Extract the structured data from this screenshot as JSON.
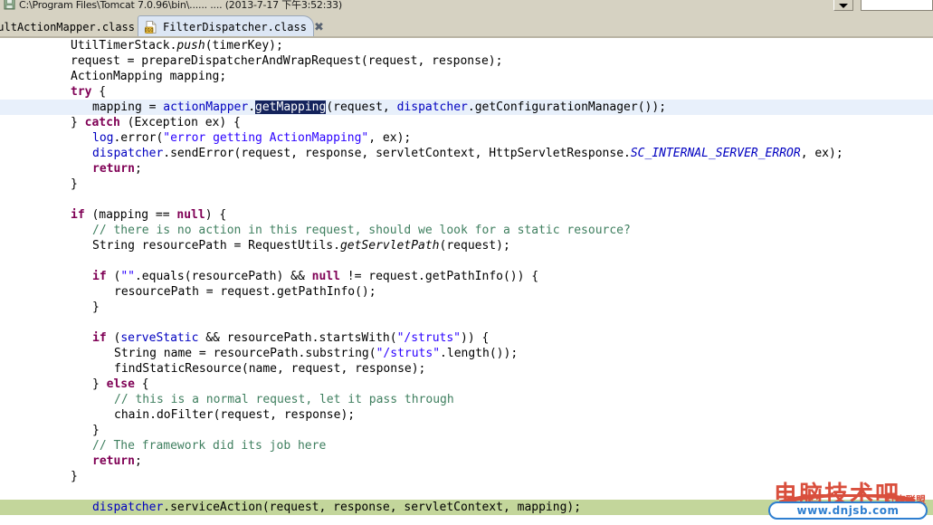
{
  "window": {
    "title": "C:\\Program Files\\Tomcat 7.0.96\\bin\\...... .... (2013-7-17 下午3:52:33)",
    "icon": "disk-save-icon",
    "combo_icon": "chevron-down-icon"
  },
  "tabs": [
    {
      "label": "ultActionMapper.class",
      "icon": "class-file-icon",
      "active": false,
      "closable": false
    },
    {
      "label": "FilterDispatcher.class",
      "icon": "class-file-icon",
      "active": true,
      "closable": true,
      "close_glyph": "✖"
    }
  ],
  "editor": {
    "selected_token": "getMapping",
    "lines": [
      {
        "indent": 1,
        "highlight": "none",
        "spans": [
          {
            "t": "UtilTimerStack."
          },
          {
            "t": "push",
            "c": "smth"
          },
          {
            "t": "(timerKey);"
          }
        ]
      },
      {
        "indent": 1,
        "highlight": "none",
        "spans": [
          {
            "t": "request = prepareDispatcherAndWrapRequest(request, response);"
          }
        ]
      },
      {
        "indent": 1,
        "highlight": "none",
        "spans": [
          {
            "t": "ActionMapping mapping;"
          }
        ]
      },
      {
        "indent": 1,
        "highlight": "none",
        "spans": [
          {
            "t": "try",
            "c": "kw"
          },
          {
            "t": " {"
          }
        ]
      },
      {
        "indent": 2,
        "highlight": "select",
        "spans": [
          {
            "t": "mapping = "
          },
          {
            "t": "actionMapper",
            "c": "fld"
          },
          {
            "t": "."
          },
          {
            "t": "getMapping",
            "c": "sel"
          },
          {
            "t": "(request, "
          },
          {
            "t": "dispatcher",
            "c": "fld"
          },
          {
            "t": ".getConfigurationManager());"
          }
        ]
      },
      {
        "indent": 1,
        "highlight": "none",
        "spans": [
          {
            "t": "} "
          },
          {
            "t": "catch",
            "c": "kw"
          },
          {
            "t": " (Exception ex) {"
          }
        ]
      },
      {
        "indent": 2,
        "highlight": "none",
        "spans": [
          {
            "t": "log",
            "c": "fld"
          },
          {
            "t": ".error("
          },
          {
            "t": "\"error getting ActionMapping\"",
            "c": "str"
          },
          {
            "t": ", ex);"
          }
        ]
      },
      {
        "indent": 2,
        "highlight": "none",
        "spans": [
          {
            "t": "dispatcher",
            "c": "fld"
          },
          {
            "t": ".sendError(request, response, servletContext, HttpServletResponse."
          },
          {
            "t": "SC_INTERNAL_SERVER_ERROR",
            "c": "sfld"
          },
          {
            "t": ", ex);"
          }
        ]
      },
      {
        "indent": 2,
        "highlight": "none",
        "spans": [
          {
            "t": "return",
            "c": "kw"
          },
          {
            "t": ";"
          }
        ]
      },
      {
        "indent": 1,
        "highlight": "none",
        "spans": [
          {
            "t": "}"
          }
        ]
      },
      {
        "indent": 0,
        "highlight": "none",
        "spans": [
          {
            "t": ""
          }
        ]
      },
      {
        "indent": 1,
        "highlight": "none",
        "spans": [
          {
            "t": "if",
            "c": "kw"
          },
          {
            "t": " (mapping == "
          },
          {
            "t": "null",
            "c": "kw"
          },
          {
            "t": ") {"
          }
        ]
      },
      {
        "indent": 2,
        "highlight": "none",
        "spans": [
          {
            "t": "// there is no action in this request, should we look for a static resource?",
            "c": "cmt"
          }
        ]
      },
      {
        "indent": 2,
        "highlight": "none",
        "spans": [
          {
            "t": "String resourcePath = RequestUtils."
          },
          {
            "t": "getServletPath",
            "c": "smth"
          },
          {
            "t": "(request);"
          }
        ]
      },
      {
        "indent": 0,
        "highlight": "none",
        "spans": [
          {
            "t": ""
          }
        ]
      },
      {
        "indent": 2,
        "highlight": "none",
        "spans": [
          {
            "t": "if",
            "c": "kw"
          },
          {
            "t": " ("
          },
          {
            "t": "\"\"",
            "c": "str"
          },
          {
            "t": ".equals(resourcePath) && "
          },
          {
            "t": "null",
            "c": "kw"
          },
          {
            "t": " != request.getPathInfo()) {"
          }
        ]
      },
      {
        "indent": 3,
        "highlight": "none",
        "spans": [
          {
            "t": "resourcePath = request.getPathInfo();"
          }
        ]
      },
      {
        "indent": 2,
        "highlight": "none",
        "spans": [
          {
            "t": "}"
          }
        ]
      },
      {
        "indent": 0,
        "highlight": "none",
        "spans": [
          {
            "t": ""
          }
        ]
      },
      {
        "indent": 2,
        "highlight": "none",
        "spans": [
          {
            "t": "if",
            "c": "kw"
          },
          {
            "t": " ("
          },
          {
            "t": "serveStatic",
            "c": "fld"
          },
          {
            "t": " && resourcePath.startsWith("
          },
          {
            "t": "\"/struts\"",
            "c": "str"
          },
          {
            "t": ")) {"
          }
        ]
      },
      {
        "indent": 3,
        "highlight": "none",
        "spans": [
          {
            "t": "String name = resourcePath.substring("
          },
          {
            "t": "\"/struts\"",
            "c": "str"
          },
          {
            "t": ".length());"
          }
        ]
      },
      {
        "indent": 3,
        "highlight": "none",
        "spans": [
          {
            "t": "findStaticResource(name, request, response);"
          }
        ]
      },
      {
        "indent": 2,
        "highlight": "none",
        "spans": [
          {
            "t": "} "
          },
          {
            "t": "else",
            "c": "kw"
          },
          {
            "t": " {"
          }
        ]
      },
      {
        "indent": 3,
        "highlight": "none",
        "spans": [
          {
            "t": "// this is a normal request, let it pass through",
            "c": "cmt"
          }
        ]
      },
      {
        "indent": 3,
        "highlight": "none",
        "spans": [
          {
            "t": "chain.doFilter(request, response);"
          }
        ]
      },
      {
        "indent": 2,
        "highlight": "none",
        "spans": [
          {
            "t": "}"
          }
        ]
      },
      {
        "indent": 2,
        "highlight": "none",
        "spans": [
          {
            "t": "// The framework did its job here",
            "c": "cmt"
          }
        ]
      },
      {
        "indent": 2,
        "highlight": "none",
        "spans": [
          {
            "t": "return",
            "c": "kw"
          },
          {
            "t": ";"
          }
        ]
      },
      {
        "indent": 1,
        "highlight": "none",
        "spans": [
          {
            "t": "}"
          }
        ]
      },
      {
        "indent": 0,
        "highlight": "none",
        "spans": [
          {
            "t": ""
          }
        ]
      },
      {
        "indent": 2,
        "highlight": "current",
        "spans": [
          {
            "t": "dispatcher",
            "c": "fld"
          },
          {
            "t": ".serviceAction(request, response, servletContext, mapping);"
          }
        ]
      }
    ]
  },
  "watermark": {
    "title_cn": "电脑技术吧",
    "subtitle_cn": "红点联盟",
    "url": "www.dnjsb.com",
    "accent": "#d94f3d",
    "url_color": "#2f7fd0"
  }
}
